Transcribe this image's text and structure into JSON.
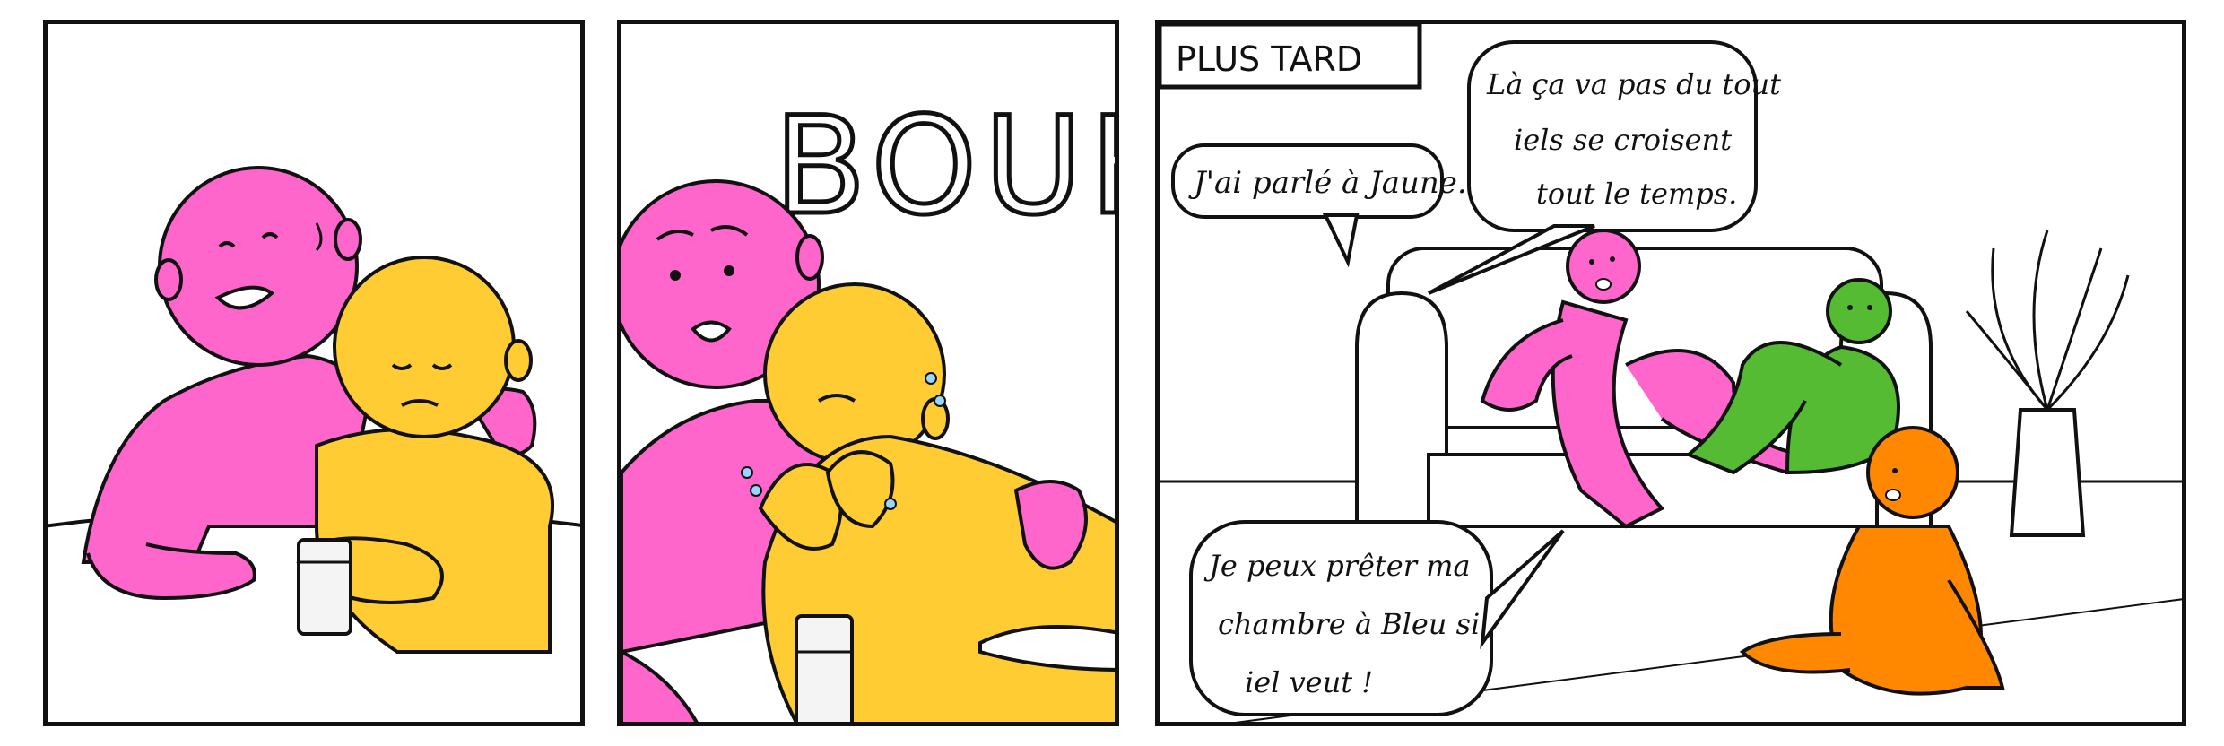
{
  "panel3": {
    "caption": "PLUS TARD",
    "bubble_pink": "J'ai parlé à Jaune.",
    "bubble_right_l1": "Là ça va pas du tout",
    "bubble_right_l2": "iels se croisent",
    "bubble_right_l3": "tout le temps.",
    "bubble_orange_l1": "Je peux prêter ma",
    "bubble_orange_l2": "chambre à Bleu si",
    "bubble_orange_l3": "iel veut !"
  },
  "panel2": {
    "sfx": "BOUHOU"
  },
  "colors": {
    "pink": "#ff66cc",
    "yellow": "#ffcc33",
    "green": "#55bb33",
    "orange": "#ff8800",
    "outline": "#111111"
  }
}
